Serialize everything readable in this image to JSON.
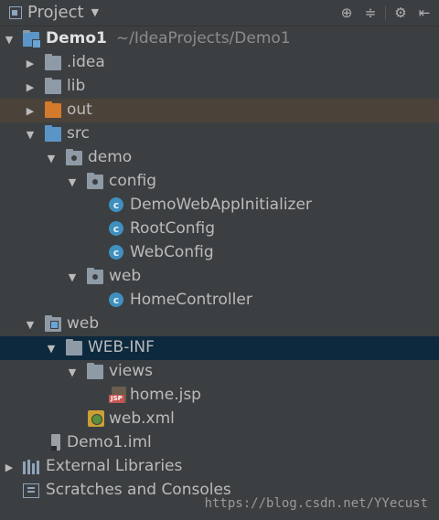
{
  "header": {
    "title": "Project",
    "tools": [
      "crosshair-icon",
      "collapse-icon",
      "gear-icon",
      "hide-icon"
    ]
  },
  "tree": {
    "root": {
      "name": "Demo1",
      "path": "~/IdeaProjects/Demo1"
    },
    "idea": ".idea",
    "lib": "lib",
    "out": "out",
    "src": "src",
    "demo": "demo",
    "config": "config",
    "c1": "DemoWebAppInitializer",
    "c2": "RootConfig",
    "c3": "WebConfig",
    "web_pkg": "web",
    "c4": "HomeController",
    "web_dir": "web",
    "webinf": "WEB-INF",
    "views": "views",
    "homejsp": "home.jsp",
    "webxml": "web.xml",
    "iml": "Demo1.iml",
    "extlib": "External Libraries",
    "scratches": "Scratches and Consoles"
  },
  "icons": {
    "class_letter": "c",
    "jsp_badge": "JSP"
  },
  "watermark": "https://blog.csdn.net/YYecust",
  "colors": {
    "background": "#3c3f41",
    "selection": "#0d293e",
    "excluded_highlight": "#4b4339"
  }
}
